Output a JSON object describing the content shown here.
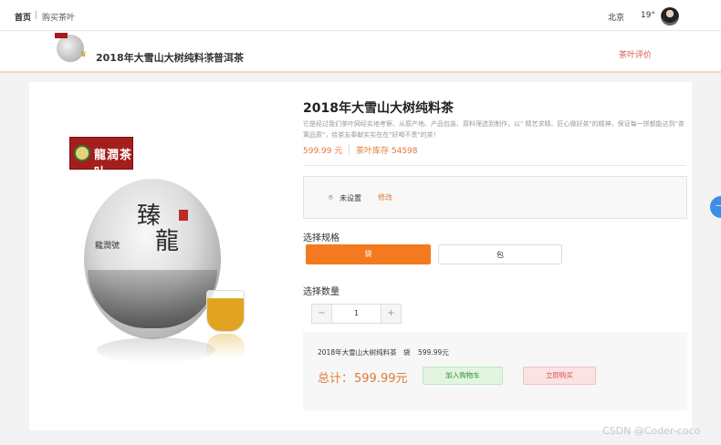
{
  "topbar": {
    "home": "首页",
    "separator": "|",
    "current": "购买茶叶",
    "city": "北京",
    "temp": "19°"
  },
  "product_bar": {
    "title": "2018年大雪山大树纯料茶",
    "category": "普洱茶",
    "review_link": "茶叶评价"
  },
  "brand_logo": {
    "text": "龍潤茶叶"
  },
  "cake_image": {
    "main_chars": [
      "臻",
      "龍"
    ],
    "left_text": "龍潤號"
  },
  "product": {
    "title": "2018年大雪山大树纯料茶",
    "description": "它是经过我们茶叶网经实地考察、从原产地、产品包装、原料筛选到制作，以\" 精艺求精、匠心做好茶\"的精神，保证每一饼都能达到\"茶寓品质\"，给茶友奉献实实在在\"好喝不贵\"的茶！",
    "price": "599.99 元",
    "stock": "茶叶库存 54598"
  },
  "address": {
    "icon": "location-pin-icon",
    "text": "未设置",
    "edit_label": "修改"
  },
  "spec": {
    "label": "选择规格",
    "options": [
      "袋",
      "包"
    ],
    "selected": "袋"
  },
  "quantity": {
    "label": "选择数量",
    "minus": "−",
    "plus": "+",
    "value": "1"
  },
  "summary": {
    "item_name": "2018年大雪山大树纯料茶",
    "item_spec": "袋",
    "item_price": "599.99元",
    "total_label": "总计：",
    "total_value": "599.99元",
    "add_cart_label": "加入购物车",
    "buy_now_label": "立即购买"
  },
  "side_tab": {
    "glyph": "—"
  },
  "watermark": "CSDN @Coder-coco",
  "colors": {
    "accent_orange": "#f47a1f",
    "price_orange": "#e07b39",
    "red": "#d9534f",
    "green": "#2f8f2f"
  }
}
